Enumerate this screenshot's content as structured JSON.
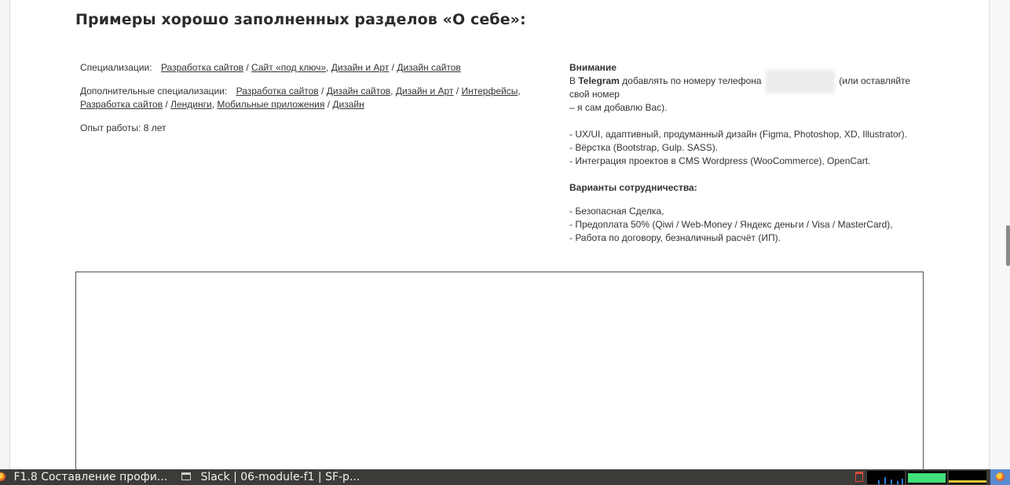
{
  "heading": "Примеры хорошо заполненных разделов «О себе»:",
  "profile_left": {
    "spec_label": "Специализации:",
    "spec_links": [
      "Разработка сайтов",
      "Сайт «под ключ»",
      "Дизайн и Арт",
      "Дизайн сайтов"
    ],
    "extra_label": "Дополнительные специализации:",
    "extra_links": [
      "Разработка сайтов",
      "Дизайн сайтов",
      "Дизайн и Арт",
      "Интерфейсы",
      "Разработка сайтов",
      "Лендинги",
      "Мобильные приложения",
      "Дизайн"
    ],
    "experience_label": "Опыт работы:",
    "experience_value": "8 лет"
  },
  "profile_right": {
    "attention_title": "Внимание",
    "telegram_prefix": "В",
    "telegram_bold": "Telegram",
    "telegram_text": "добавлять по номеру телефона",
    "telegram_suffix": "(или оставляйте свой номер",
    "telegram_line2": "– я сам добавлю Вас).",
    "skills": [
      "- UX/UI, адаптивный, продуманный дизайн (Figma, Photoshop, XD, Illustrator).",
      "- Вёрстка (Bootstrap, Gulp. SASS).",
      "- Интеграция проектов в CMS Wordpress (WooCommerce), OpenCart."
    ],
    "coop_title": "Варианты сотрудничества:",
    "coop_items": [
      "- Безопасная Сделка,",
      "- Предоплата 50% (Qiwi / Web-Money / Яндекс деньги / Visa / MasterCard),",
      "- Работа по договору, безналичный расчёт (ИП)."
    ]
  },
  "taskbar": {
    "task1": "F1.8 Составление профи...",
    "task2": "Slack | 06-module-f1 | SF-p..."
  },
  "colors": {
    "taskbar_bg": "#3c3b37",
    "text": "#333333",
    "monitor_green": "#42e07a",
    "monitor_blue": "#2a7de1"
  }
}
